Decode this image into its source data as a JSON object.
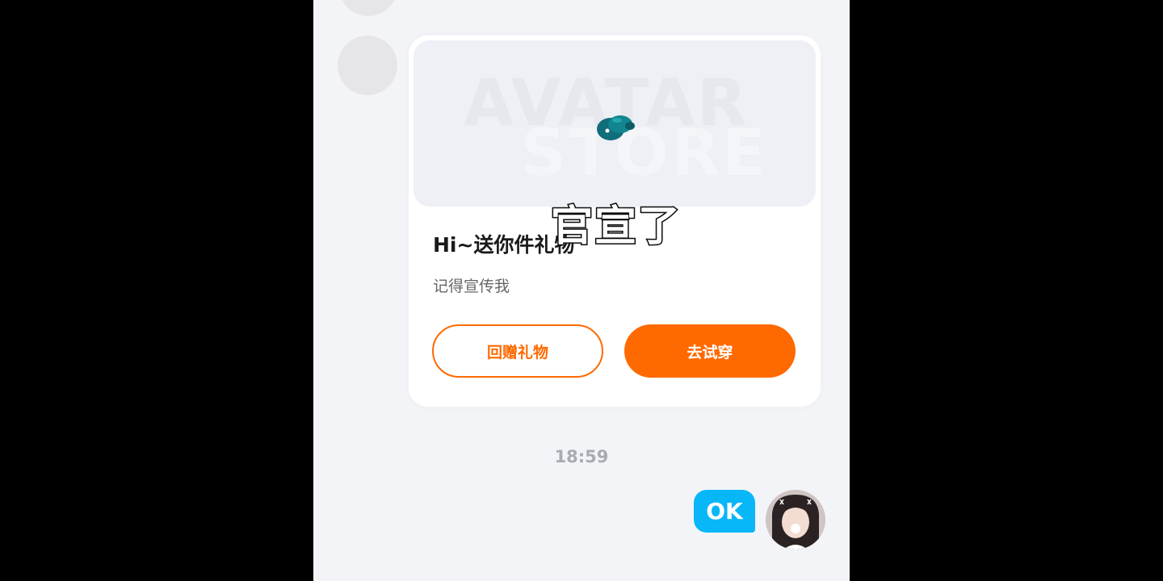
{
  "chat": {
    "gift_card": {
      "banner_text_line1": "AVATAR",
      "banner_text_line2": "STORE",
      "title": "Hi~送你件礼物",
      "subtitle": "记得宣传我",
      "return_gift_label": "回赠礼物",
      "try_on_label": "去试穿"
    },
    "timestamp": "18:59",
    "my_message": "OK"
  },
  "overlay": {
    "caption": "官宣了"
  },
  "colors": {
    "accent_orange": "#ff6a00",
    "bubble_blue": "#08b7f8",
    "chat_background": "#f3f4f8"
  }
}
